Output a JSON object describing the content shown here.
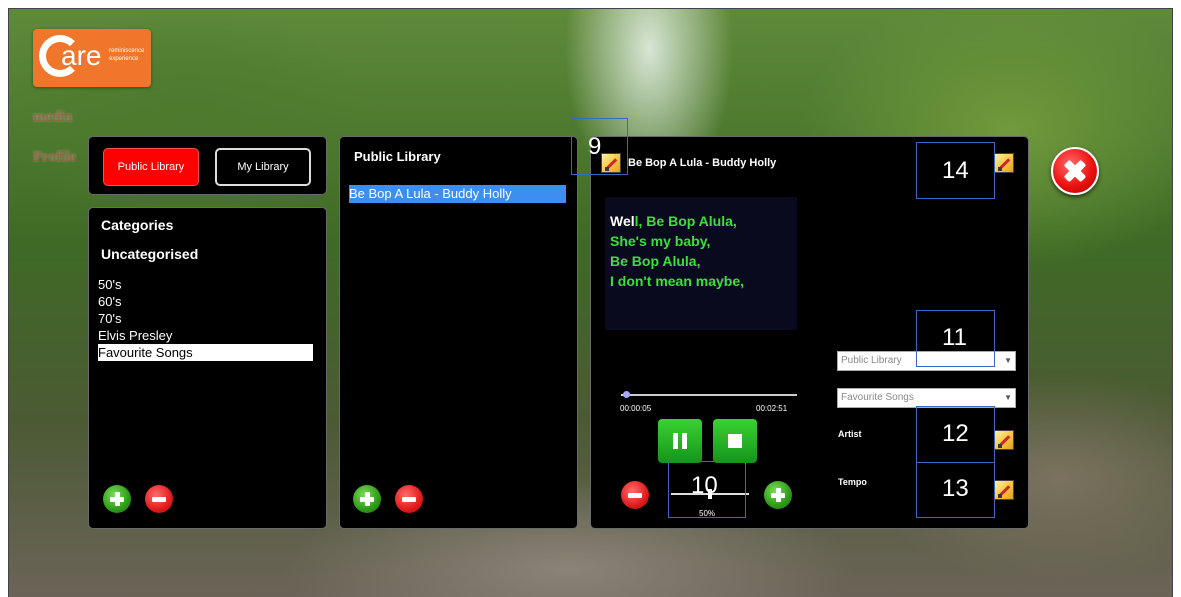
{
  "logo": {
    "brand": "are",
    "tagline": "reminiscence experience"
  },
  "side_ghost": {
    "item1": "media",
    "item2": "Profile"
  },
  "library_tabs": {
    "public": "Public Library",
    "my": "My Library"
  },
  "categories": {
    "title": "Categories",
    "uncategorised": "Uncategorised",
    "items": [
      "50's",
      "60's",
      "70's",
      "Elvis Presley",
      "Favourite Songs"
    ],
    "selected": "Favourite Songs"
  },
  "library_panel": {
    "title": "Public Library",
    "songs": [
      "Be Bop A Lula - Buddy Holly"
    ]
  },
  "player": {
    "song_title": "Be Bop A Lula - Buddy Holly",
    "lyrics": [
      {
        "white": "Wel",
        "green": "l, Be Bop Alula,"
      },
      {
        "white": "",
        "green": "She's my baby,"
      },
      {
        "white": "",
        "green": "Be Bop Alula,"
      },
      {
        "white": "",
        "green": "I don't mean maybe,"
      }
    ],
    "elapsed": "00:00:05",
    "duration": "00:02:51",
    "progress_fraction": 0.03,
    "tempo_value": "50%",
    "tempo_fraction": 0.5,
    "library_select": "Public Library",
    "category_select": "Favourite Songs",
    "artist_label": "Artist",
    "tempo_label": "Tempo"
  },
  "annotations": {
    "n9": "9",
    "n10": "10",
    "n11": "11",
    "n12": "12",
    "n13": "13",
    "n14": "14"
  },
  "colors": {
    "accent_red": "#ff0000",
    "highlight": "#3c8ef0",
    "lyric_green": "#39e13a",
    "logo_orange": "#f0762b"
  }
}
